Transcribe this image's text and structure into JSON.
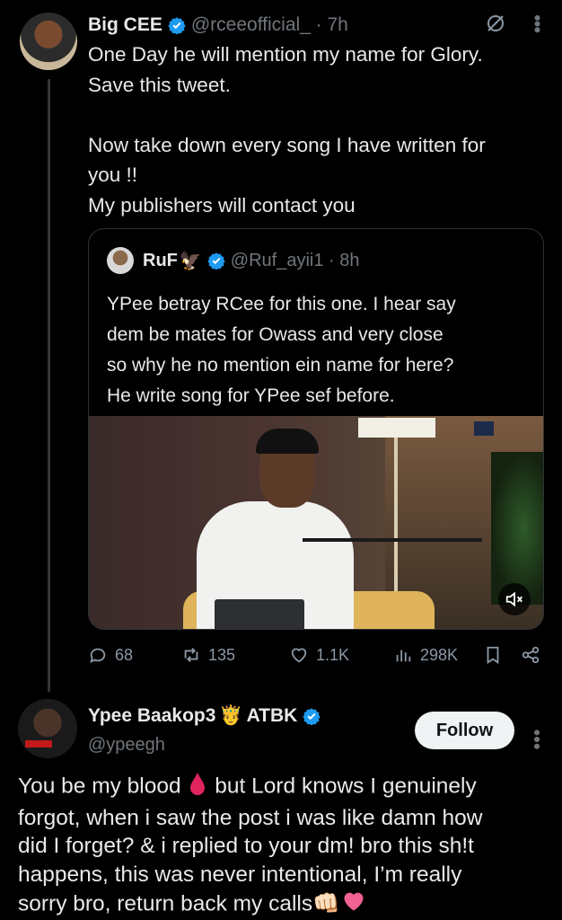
{
  "tweet1": {
    "name": "Big CEE",
    "handle": "@rceeofficial_ · 7h",
    "text": "One Day he will mention my name for Glory.\nSave this tweet.\n\nNow take down every song I have written for\nyou !!\nMy publishers will contact you",
    "quote": {
      "name": "RuF",
      "handle": "@Ruf_ayii1 · 8h",
      "text": "YPee betray RCee for this one. I hear say\ndem be mates for Owass and very close\nso why he no mention ein name for here?\nHe write song for YPee sef before."
    },
    "stats": {
      "replies": "68",
      "reposts": "135",
      "likes": "1.1K",
      "views": "298K"
    }
  },
  "tweet2": {
    "name": "Ypee Baakop3",
    "name_suffix": "ATBK",
    "handle": "@ypeegh",
    "follow_label": "Follow",
    "text_a": "You be my blood ",
    "text_b": " but Lord knows I genuinely\nforgot, when i saw the post i was like damn how\ndid I forget? & i replied to your dm! bro this sh!t\nhappens, this was never intentional, I’m really\nsorry bro, return back my calls"
  },
  "colors": {
    "background": "#000000",
    "text": "#e7e9ea",
    "muted": "#71767b",
    "verified": "#1d9bf0",
    "border": "#2f3336"
  },
  "icons": [
    "verified-badge-icon",
    "grok-icon",
    "more-icon",
    "reply-icon",
    "repost-icon",
    "like-icon",
    "views-icon",
    "bookmark-icon",
    "share-icon",
    "sound-icon",
    "crown-emoji",
    "blood-drop-emoji",
    "fist-bump-emoji",
    "heart-emoji"
  ]
}
